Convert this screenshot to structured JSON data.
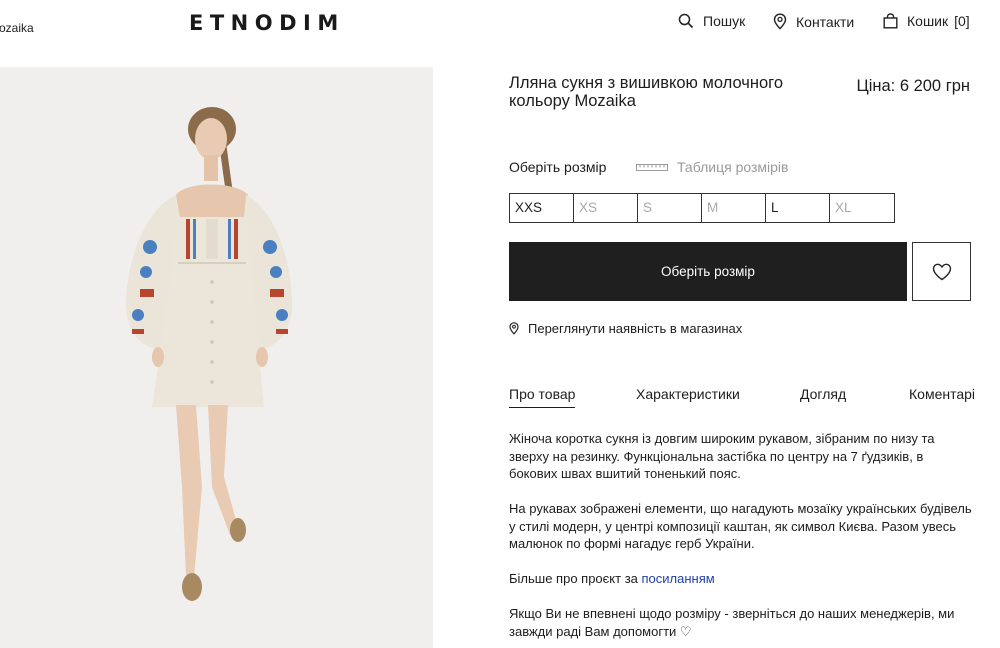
{
  "header": {
    "breadcrumb": "ozaika",
    "logo": "ETNODIM",
    "search_label": "Пошук",
    "contacts_label": "Контакти",
    "cart_label": "Кошик",
    "cart_count": "[0]"
  },
  "product": {
    "title": "Лляна сукня з вишивкою молочного кольору Mozaika",
    "price": "Ціна: 6 200 грн",
    "choose_size_label": "Оберіть розмір",
    "size_table_label": "Таблиця розмірів",
    "sizes": [
      {
        "label": "XXS",
        "available": true
      },
      {
        "label": "XS",
        "available": false
      },
      {
        "label": "S",
        "available": false
      },
      {
        "label": "M",
        "available": false
      },
      {
        "label": "L",
        "available": true
      },
      {
        "label": "XL",
        "available": false
      }
    ],
    "cta_label": "Оберіть розмір",
    "store_availability_label": "Переглянути наявність в магазинах"
  },
  "tabs": [
    {
      "label": "Про товар",
      "active": true
    },
    {
      "label": "Характеристики",
      "active": false
    },
    {
      "label": "Догляд",
      "active": false
    },
    {
      "label": "Коментарі",
      "active": false
    }
  ],
  "description": {
    "p1": "Жіноча коротка сукня із довгим широким рукавом, зібраним по низу та зверху на резинку. Функціональна застібка по центру на 7 ґудзиків, в бокових швах вшитий тоненький пояс.",
    "p2": "На рукавах зображені елементи, що нагадують мозаїку українських будівель у стилі модерн, у центрі композиції каштан, як символ Києва. Разом увесь малюнок по формі нагадує герб України.",
    "p3_prefix": "Більше про проєкт за ",
    "p3_link": "посиланням",
    "p4": "Якщо Ви не впевнені щодо розміру - зверніться до наших менеджерів, ми завжди раді Вам допомогти ♡"
  },
  "colors": {
    "text": "#1d1d1d",
    "muted": "#a9a9a9",
    "button_bg": "#1f1f1f",
    "link": "#1f3fa8",
    "photo_bg": "#f0efee",
    "dress": "#ece6da",
    "embroidery_red": "#b8462e",
    "embroidery_blue": "#4a7fc0"
  },
  "icons": {
    "search": "search-icon",
    "contacts": "location-pin-icon",
    "cart": "shopping-bag-icon",
    "size_table": "ruler-icon",
    "wishlist": "heart-icon",
    "stores": "location-pin-icon"
  }
}
